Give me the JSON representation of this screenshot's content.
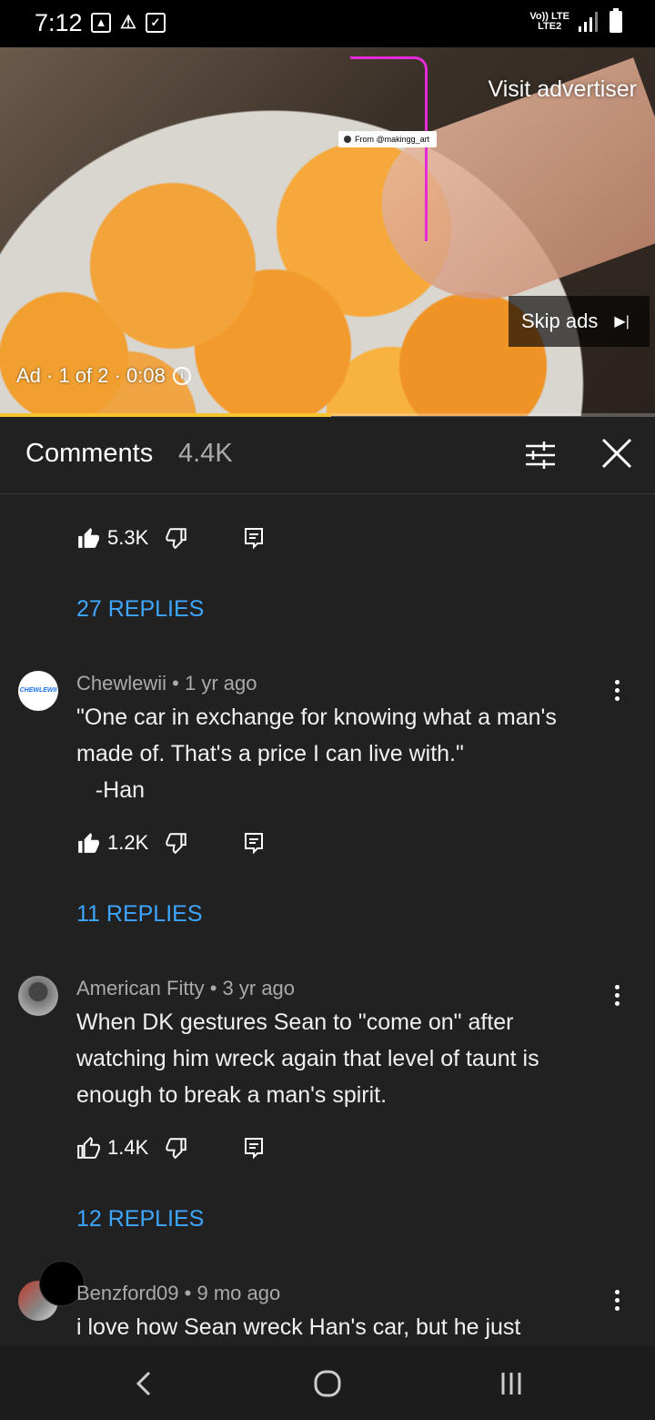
{
  "status_bar": {
    "time": "7:12",
    "network_top": "Vo)) LTE",
    "network_bottom": "LTE2"
  },
  "ad": {
    "visit_label": "Visit advertiser",
    "tag_label": "From @makingg_art",
    "skip_label": "Skip ads",
    "info_label": "Ad · 1 of 2 · 0:08",
    "progress_fraction": 0.505
  },
  "comments": {
    "title": "Comments",
    "count": "4.4K",
    "items": [
      {
        "likes": "5.3K",
        "replies_label": "27 REPLIES"
      },
      {
        "author": "Chewlewii",
        "age": "1 yr ago",
        "text": "\"One car in exchange for knowing what a man's made of. That's a price I can live with.\"\n   -Han",
        "likes": "1.2K",
        "replies_label": "11 REPLIES",
        "avatar_text": "CHEWLEWII",
        "liked": true
      },
      {
        "author": "American Fitty",
        "age": "3 yr ago",
        "text": "When DK gestures Sean to \"come on\" after watching him wreck again that level of taunt is enough to break a man's spirit.",
        "likes": "1.4K",
        "replies_label": "12 REPLIES",
        "liked": false
      },
      {
        "author": "Benzford09",
        "age": "9 mo ago",
        "text": "i love how Sean wreck Han's car, but he just"
      }
    ]
  },
  "colors": {
    "background": "#212121",
    "link": "#3ea6ff",
    "progress": "#f7c52b",
    "ad_line": "#e52ad9"
  },
  "icons": [
    "image-icon",
    "alert-icon",
    "check-icon",
    "signal-icon",
    "battery-icon",
    "thumbs-up-icon",
    "thumbs-down-icon",
    "reply-icon",
    "more-vert-icon",
    "sort-icon",
    "close-icon",
    "back-icon",
    "home-icon",
    "recents-icon"
  ]
}
